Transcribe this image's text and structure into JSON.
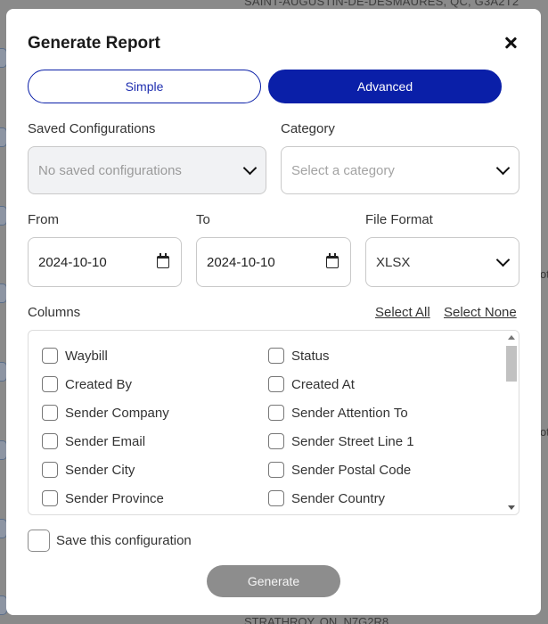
{
  "background": {
    "top_text": "SAINT-AUGUSTIN-DE-DESMAURES, QC, G3A2T2",
    "bottom_text": "STRATHROY, ON, N7G2R8",
    "right_edge_text_1": "ot",
    "right_edge_text_2": "ot"
  },
  "modal": {
    "title": "Generate Report",
    "mode_tabs": {
      "simple": "Simple",
      "advanced": "Advanced",
      "active": "Advanced"
    },
    "saved_configurations": {
      "label": "Saved Configurations",
      "placeholder": "No saved configurations"
    },
    "category": {
      "label": "Category",
      "placeholder": "Select a category"
    },
    "from": {
      "label": "From",
      "value": "2024-10-10"
    },
    "to": {
      "label": "To",
      "value": "2024-10-10"
    },
    "file_format": {
      "label": "File Format",
      "value": "XLSX"
    },
    "columns": {
      "label": "Columns",
      "select_all": "Select All",
      "select_none": "Select None",
      "left": [
        "Waybill",
        "Created By",
        "Sender Company",
        "Sender Email",
        "Sender City",
        "Sender Province"
      ],
      "right": [
        "Status",
        "Created At",
        "Sender Attention To",
        "Sender Street Line 1",
        "Sender Postal Code",
        "Sender Country"
      ]
    },
    "save_configuration_label": "Save this configuration",
    "generate_label": "Generate"
  },
  "colors": {
    "accent": "#0a1fa8",
    "disabled_button": "#8d8d8d",
    "disabled_field": "#f1f2f4"
  }
}
